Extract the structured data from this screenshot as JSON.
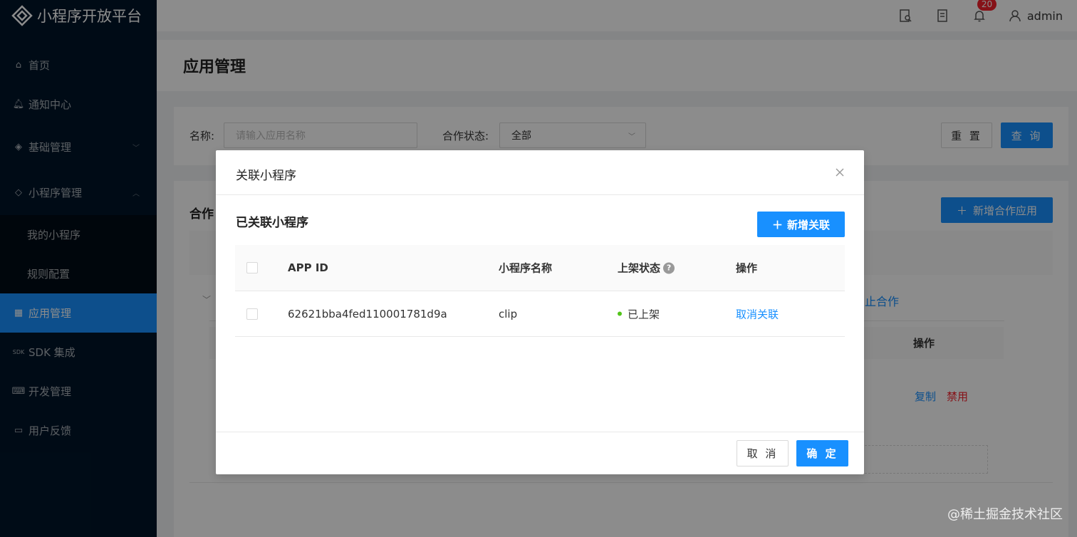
{
  "app": {
    "logo_text": "小程序开放平台"
  },
  "sidebar": {
    "items": [
      {
        "label": "首页",
        "icon": "home-icon"
      },
      {
        "label": "通知中心",
        "icon": "bell-icon"
      },
      {
        "label": "基础管理",
        "icon": "layers-icon"
      },
      {
        "label": "小程序管理",
        "icon": "diamond-icon"
      },
      {
        "label": "我的小程序"
      },
      {
        "label": "规则配置"
      },
      {
        "label": "应用管理",
        "icon": "grid-icon"
      },
      {
        "label": "SDK 集成",
        "icon": "sdk-icon"
      },
      {
        "label": "开发管理",
        "icon": "code-icon"
      },
      {
        "label": "用户反馈",
        "icon": "message-icon"
      }
    ]
  },
  "header": {
    "notification_count": "20",
    "username": "admin"
  },
  "page": {
    "title": "应用管理"
  },
  "filter": {
    "name_label": "名称:",
    "name_placeholder": "请输入应用名称",
    "status_label": "合作状态:",
    "status_value": "全部",
    "reset_label": "重 置",
    "query_label": "查 询"
  },
  "list": {
    "title_partial": "合作",
    "add_button": "新增合作应用",
    "bg_link_partial": "止合作",
    "inner_op_header": "操作",
    "copy_label": "复制",
    "disable_label": "禁用"
  },
  "modal": {
    "title": "关联小程序",
    "section_title": "已关联小程序",
    "add_button": "新增关联",
    "columns": [
      "APP ID",
      "小程序名称",
      "上架状态",
      "操作"
    ],
    "rows": [
      {
        "app_id": "62621bba4fed110001781d9a",
        "name": "clip",
        "status": "已上架",
        "action": "取消关联"
      }
    ],
    "cancel_label": "取 消",
    "ok_label": "确 定"
  },
  "watermark": "@稀土掘金技术社区",
  "colors": {
    "primary": "#1890ff",
    "sidebar_bg": "#001529",
    "danger": "#f5222d",
    "success": "#52c41a"
  }
}
